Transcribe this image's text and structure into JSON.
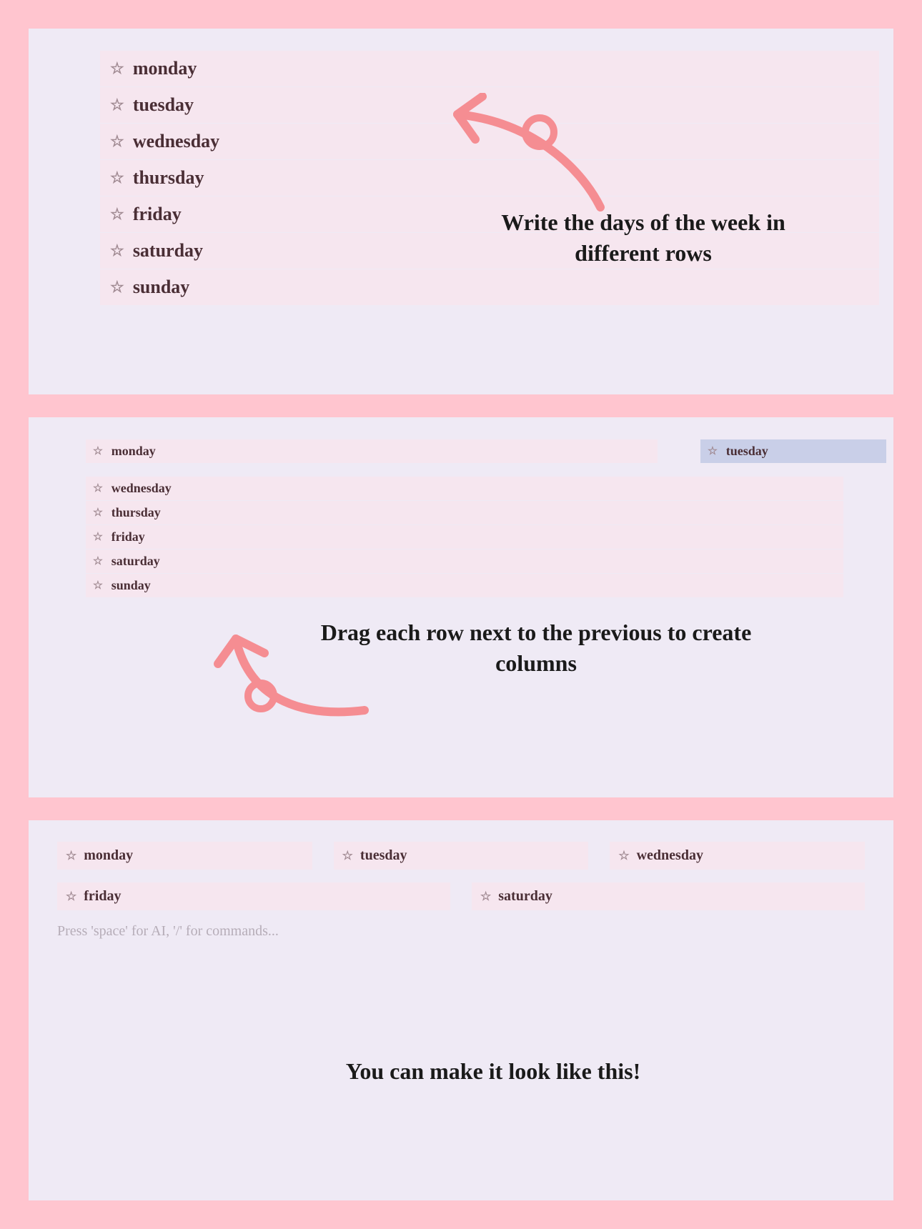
{
  "panel1": {
    "days": [
      "monday",
      "tuesday",
      "wednesday",
      "thursday",
      "friday",
      "saturday",
      "sunday"
    ],
    "note": "Write the days of the week in different rows"
  },
  "panel2": {
    "dragged": "tuesday",
    "first": "monday",
    "rest": [
      "wednesday",
      "thursday",
      "friday",
      "saturday",
      "sunday"
    ],
    "note": "Drag each row next to the previous to create columns"
  },
  "panel3": {
    "row1": [
      "monday",
      "tuesday",
      "wednesday"
    ],
    "row2": [
      "friday",
      "saturday"
    ],
    "placeholder": "Press 'space' for AI, '/' for commands...",
    "note": "You can make it look like this!"
  },
  "icons": {
    "star": "☆"
  },
  "colors": {
    "bg": "#ffc5cf",
    "panel": "#efeaf5",
    "row": "#f6e6ef",
    "dragRow": "#c9cfe8",
    "text": "#4a2e35",
    "arrow": "#f58d92"
  }
}
